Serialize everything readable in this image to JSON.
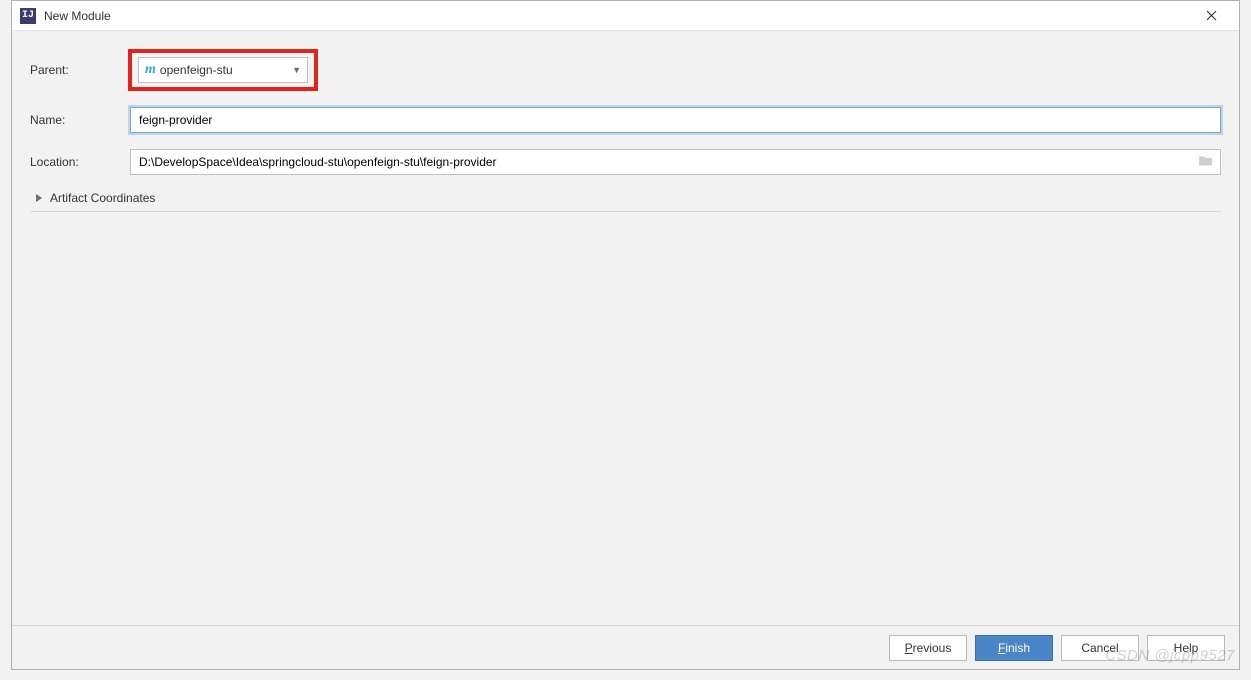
{
  "window": {
    "title": "New Module"
  },
  "form": {
    "parent": {
      "label": "Parent:",
      "value": "openfeign-stu",
      "icon": "m"
    },
    "name": {
      "label": "Name:",
      "value": "feign-provider"
    },
    "location": {
      "label": "Location:",
      "value": "D:\\DevelopSpace\\Idea\\springcloud-stu\\openfeign-stu\\feign-provider"
    },
    "artifact": {
      "label": "Artifact Coordinates"
    }
  },
  "buttons": {
    "previous": "Previous",
    "finish": "Finish",
    "cancel": "Cancel",
    "help": "Help"
  },
  "watermark": "CSDN @jcpp9527"
}
